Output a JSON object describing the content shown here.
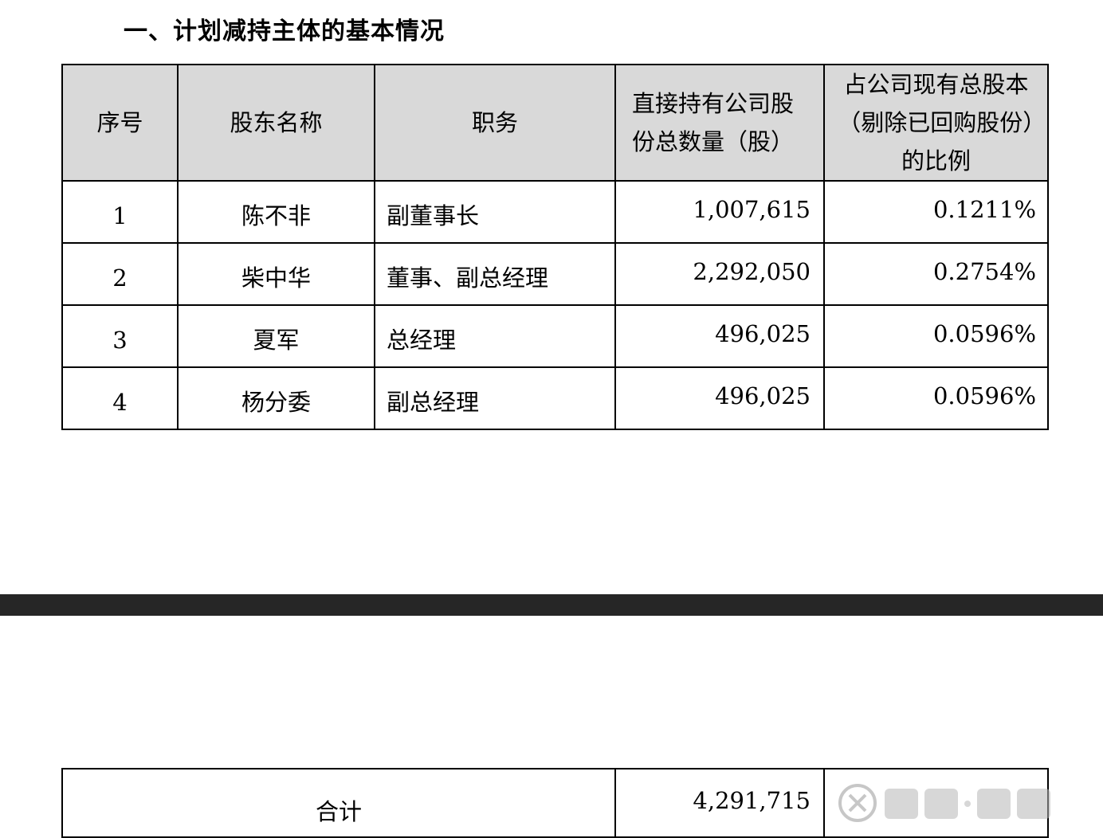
{
  "section_title": "一、计划减持主体的基本情况",
  "table": {
    "headers": [
      "序号",
      "股东名称",
      "职务",
      "直接持有公司股份总数量（股）",
      "占公司现有总股本（剔除已回购股份）的比例"
    ],
    "rows": [
      {
        "idx": "1",
        "name": "陈不非",
        "position": "副董事长",
        "shares": "1,007,615",
        "ratio": "0.1211%"
      },
      {
        "idx": "2",
        "name": "柴中华",
        "position": "董事、副总经理",
        "shares": "2,292,050",
        "ratio": "0.2754%"
      },
      {
        "idx": "3",
        "name": "夏军",
        "position": "总经理",
        "shares": "496,025",
        "ratio": "0.0596%"
      },
      {
        "idx": "4",
        "name": "杨分委",
        "position": "副总经理",
        "shares": "496,025",
        "ratio": "0.0596%"
      }
    ]
  },
  "total": {
    "label": "合计",
    "shares": "4,291,715"
  }
}
